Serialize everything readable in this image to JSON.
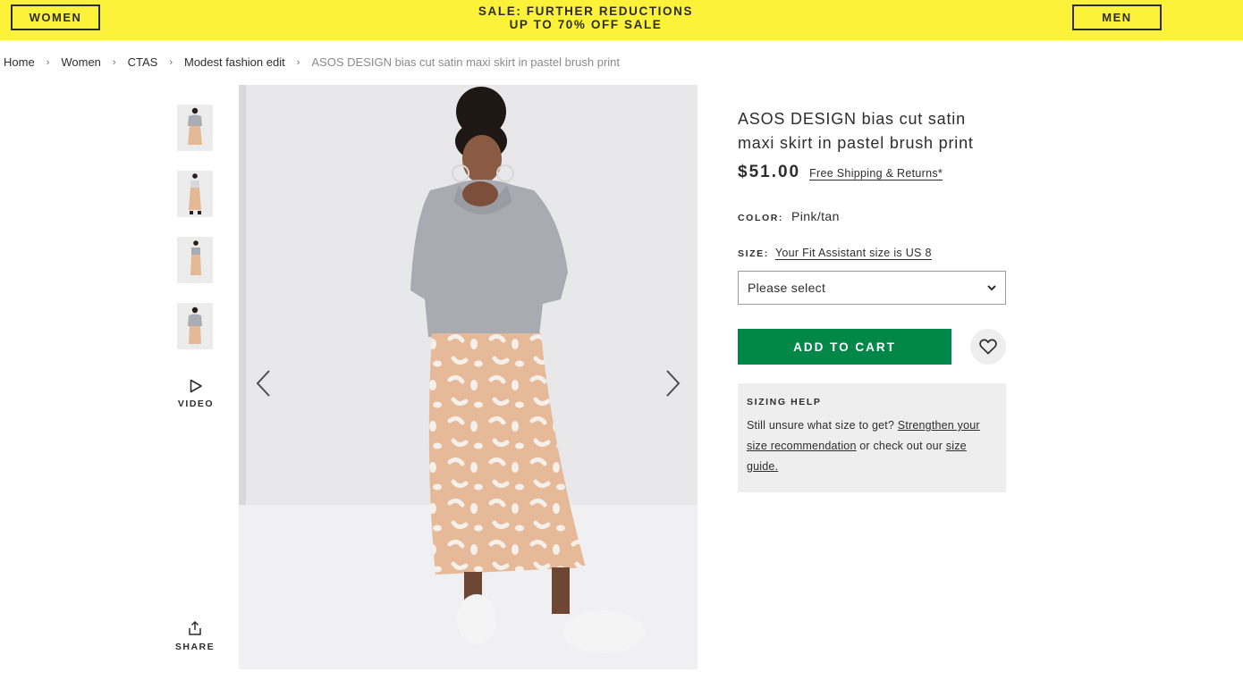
{
  "promo": {
    "women_label": "WOMEN",
    "men_label": "MEN",
    "line1": "SALE: FURTHER REDUCTIONS",
    "line2": "UP TO 70% OFF SALE",
    "background_color": "#fdf23a"
  },
  "breadcrumb": {
    "items": [
      "Home",
      "Women",
      "CTAS",
      "Modest fashion edit"
    ],
    "current": "ASOS DESIGN bias cut satin maxi skirt in pastel brush print",
    "separator": "›"
  },
  "gallery": {
    "thumbnail_count": 4,
    "video_label": "VIDEO",
    "share_label": "SHARE",
    "icons": {
      "video": "play-icon",
      "share": "share-icon",
      "prev": "chevron-left-icon",
      "next": "chevron-right-icon"
    }
  },
  "product": {
    "title_line1": "ASOS DESIGN bias cut satin",
    "title_line2": "maxi skirt in pastel brush print",
    "price": "$51.00",
    "shipping_link": "Free Shipping & Returns*",
    "color_label": "COLOR:",
    "color_value": "Pink/tan",
    "size_label": "SIZE:",
    "fit_assistant_link": "Your Fit Assistant size is US 8",
    "size_select_value": "Please select",
    "add_to_cart_label": "ADD TO CART",
    "save_icon": "heart-icon",
    "cta_color": "#018849"
  },
  "sizing_help": {
    "title": "SIZING HELP",
    "text_before": "Still unsure what size to get? ",
    "link1": "Strengthen your size recommendation",
    "text_middle": " or check out our ",
    "link2": "size guide."
  }
}
